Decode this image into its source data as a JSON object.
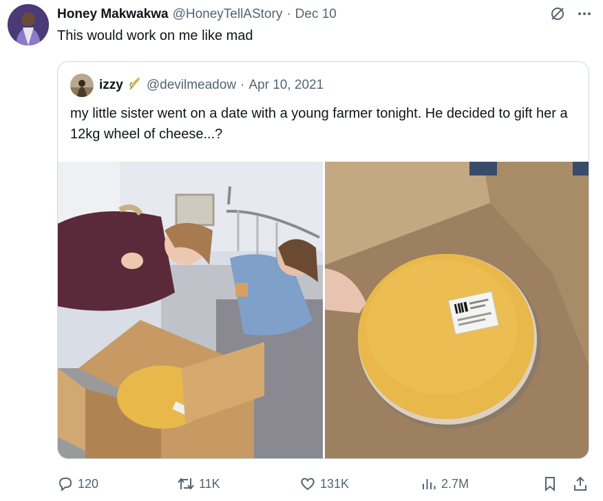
{
  "tweet": {
    "author_name": "Honey Makwakwa",
    "handle": "@HoneyTellAStory",
    "separator": "·",
    "date": "Dec 10",
    "text": "This would work on me like mad"
  },
  "quoted_tweet": {
    "author_name": "izzy",
    "handle": "@devilmeadow",
    "separator": "·",
    "date": "Apr 10, 2021",
    "text": "my little sister went on a date with a young farmer tonight. He decided to gift her a 12kg wheel of cheese...?"
  },
  "actions": {
    "replies": "120",
    "reposts": "11K",
    "likes": "131K",
    "views": "2.7M"
  },
  "icons": {
    "grok": "slashed-circle-icon",
    "more": "more-icon",
    "reply": "reply-icon",
    "repost": "repost-icon",
    "like": "heart-icon",
    "views": "views-icon",
    "bookmark": "bookmark-icon",
    "share": "share-icon",
    "badge": "wheat-emoji-icon"
  },
  "colors": {
    "text": "#0f1419",
    "muted": "#536471",
    "border": "#cfd9de",
    "cheese": "#e8b84a"
  }
}
